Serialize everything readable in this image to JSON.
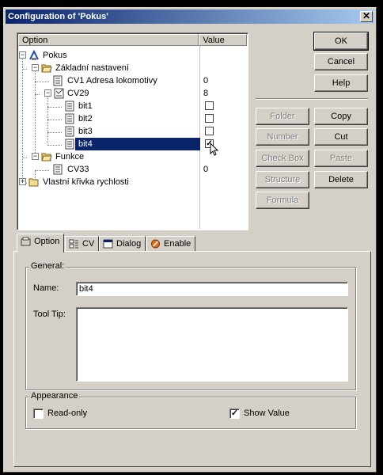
{
  "window": {
    "title": "Configuration of 'Pokus'",
    "close_glyph": "✕"
  },
  "tree": {
    "columns": [
      "Option",
      "Value"
    ],
    "rows": [
      {
        "label": "Pokus",
        "value": "",
        "icon": "root-icon"
      },
      {
        "label": "Základní nastavení",
        "value": "",
        "icon": "folder-open-icon"
      },
      {
        "label": "CV1 Adresa lokomotivy",
        "value": "0",
        "icon": "cv-icon"
      },
      {
        "label": "CV29",
        "value": "8",
        "icon": "cv-bits-icon"
      },
      {
        "label": "bit1",
        "value": "",
        "checked": false
      },
      {
        "label": "bit2",
        "value": "",
        "checked": false
      },
      {
        "label": "bit3",
        "value": "",
        "checked": false
      },
      {
        "label": "bit4",
        "value": "",
        "checked": true
      },
      {
        "label": "Funkce",
        "value": "",
        "icon": "folder-open-icon"
      },
      {
        "label": "CV33",
        "value": "0",
        "icon": "cv-icon"
      },
      {
        "label": "Vlastní křivka rychlosti",
        "value": "",
        "icon": "folder-icon"
      }
    ],
    "expander_minus": "−",
    "expander_plus": "+",
    "check_mark": "✓"
  },
  "buttons": {
    "ok": "OK",
    "cancel": "Cancel",
    "help": "Help",
    "folder": "Folder",
    "copy": "Copy",
    "number": "Number",
    "cut": "Cut",
    "checkbox": "Check Box",
    "paste": "Paste",
    "structure": "Structure",
    "delete": "Delete",
    "formula": "Formula"
  },
  "tabs": [
    {
      "label": "Option",
      "icon": "option-icon"
    },
    {
      "label": "CV",
      "icon": "cv-tab-icon"
    },
    {
      "label": "Dialog",
      "icon": "dialog-icon"
    },
    {
      "label": "Enable",
      "icon": "enable-icon"
    }
  ],
  "option_tab": {
    "general_label": "General:",
    "name_label": "Name:",
    "name_value": "bit4",
    "tooltip_label": "Tool Tip:",
    "tooltip_value": "",
    "appearance_label": "Appearance",
    "readonly_label": "Read-only",
    "readonly_checked": false,
    "showvalue_label": "Show Value",
    "showvalue_checked": true
  }
}
